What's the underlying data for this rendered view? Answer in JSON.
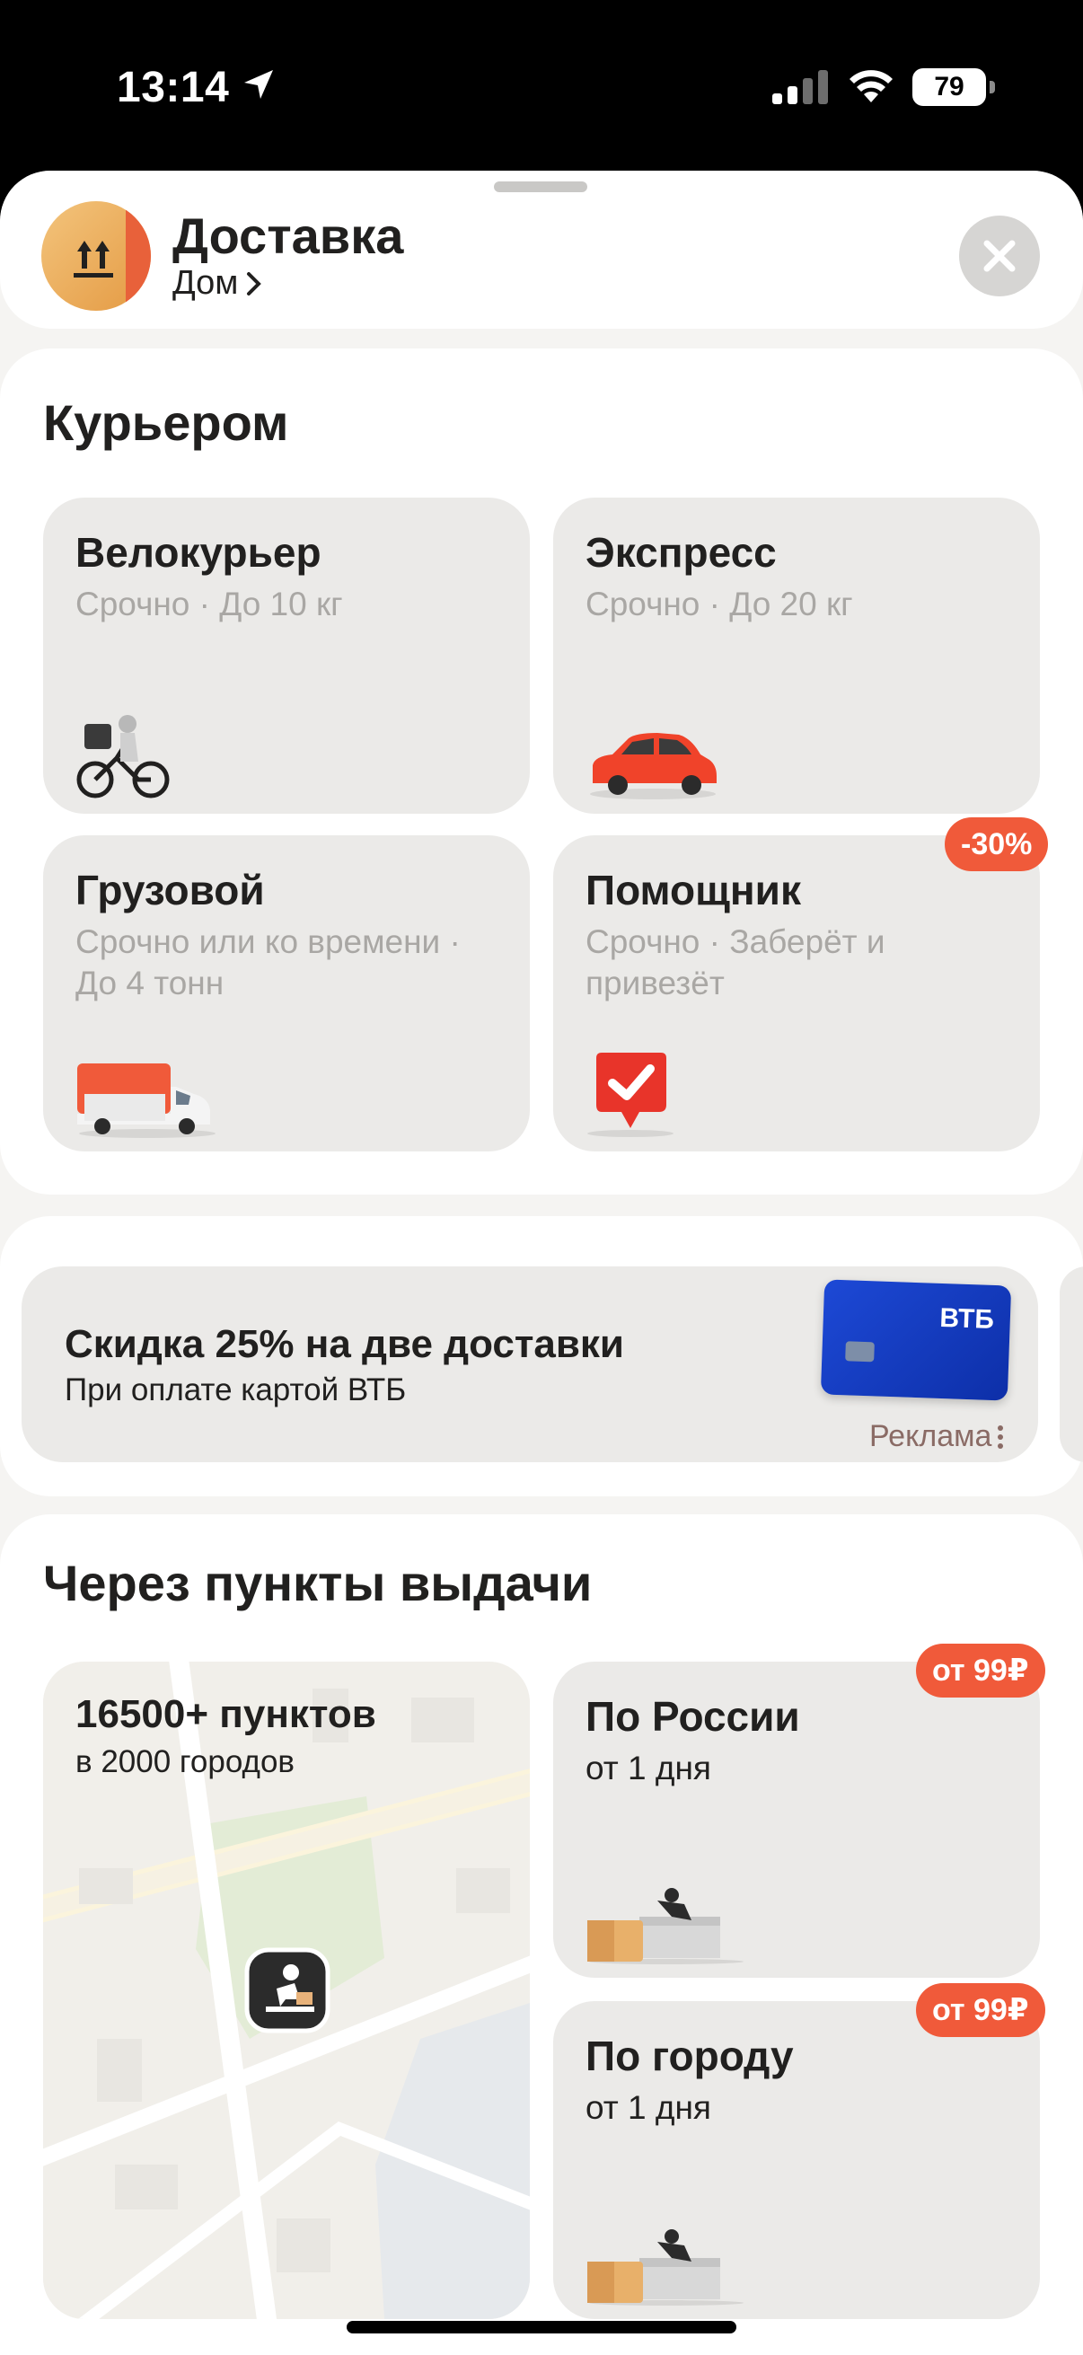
{
  "status_bar": {
    "time": "13:14",
    "battery": "79"
  },
  "header": {
    "title": "Доставка",
    "subtitle": "Дом"
  },
  "courier": {
    "title": "Курьером",
    "cards": [
      {
        "title": "Велокурьер",
        "subtitle": "Срочно · До 10 кг",
        "icon": "bike-courier-icon"
      },
      {
        "title": "Экспресс",
        "subtitle": "Срочно · До 20 кг",
        "icon": "car-icon"
      },
      {
        "title": "Грузовой",
        "subtitle": "Срочно или ко времени · До 4 тонн",
        "icon": "truck-icon"
      },
      {
        "title": "Помощник",
        "subtitle": "Срочно · Заберёт и привезёт",
        "icon": "checkmark-pin-icon",
        "badge": "-30%"
      }
    ]
  },
  "promo": {
    "title": "Скидка 25% на две доставки",
    "subtitle": "При оплате картой ВТБ",
    "card_logo": "ВТБ",
    "ad_label": "Реклама"
  },
  "pickup": {
    "title": "Через пункты выдачи",
    "map_card": {
      "title": "16500+ пунктов",
      "subtitle": "в 2000 городов"
    },
    "cards": [
      {
        "title": "По России",
        "subtitle": "от 1 дня",
        "badge": "от 99₽"
      },
      {
        "title": "По городу",
        "subtitle": "от 1 дня",
        "badge": "от 99₽"
      }
    ]
  },
  "colors": {
    "accent": "#f05a3a",
    "card_bg": "#ebeae8",
    "vtb_blue": "#1d49d6"
  }
}
